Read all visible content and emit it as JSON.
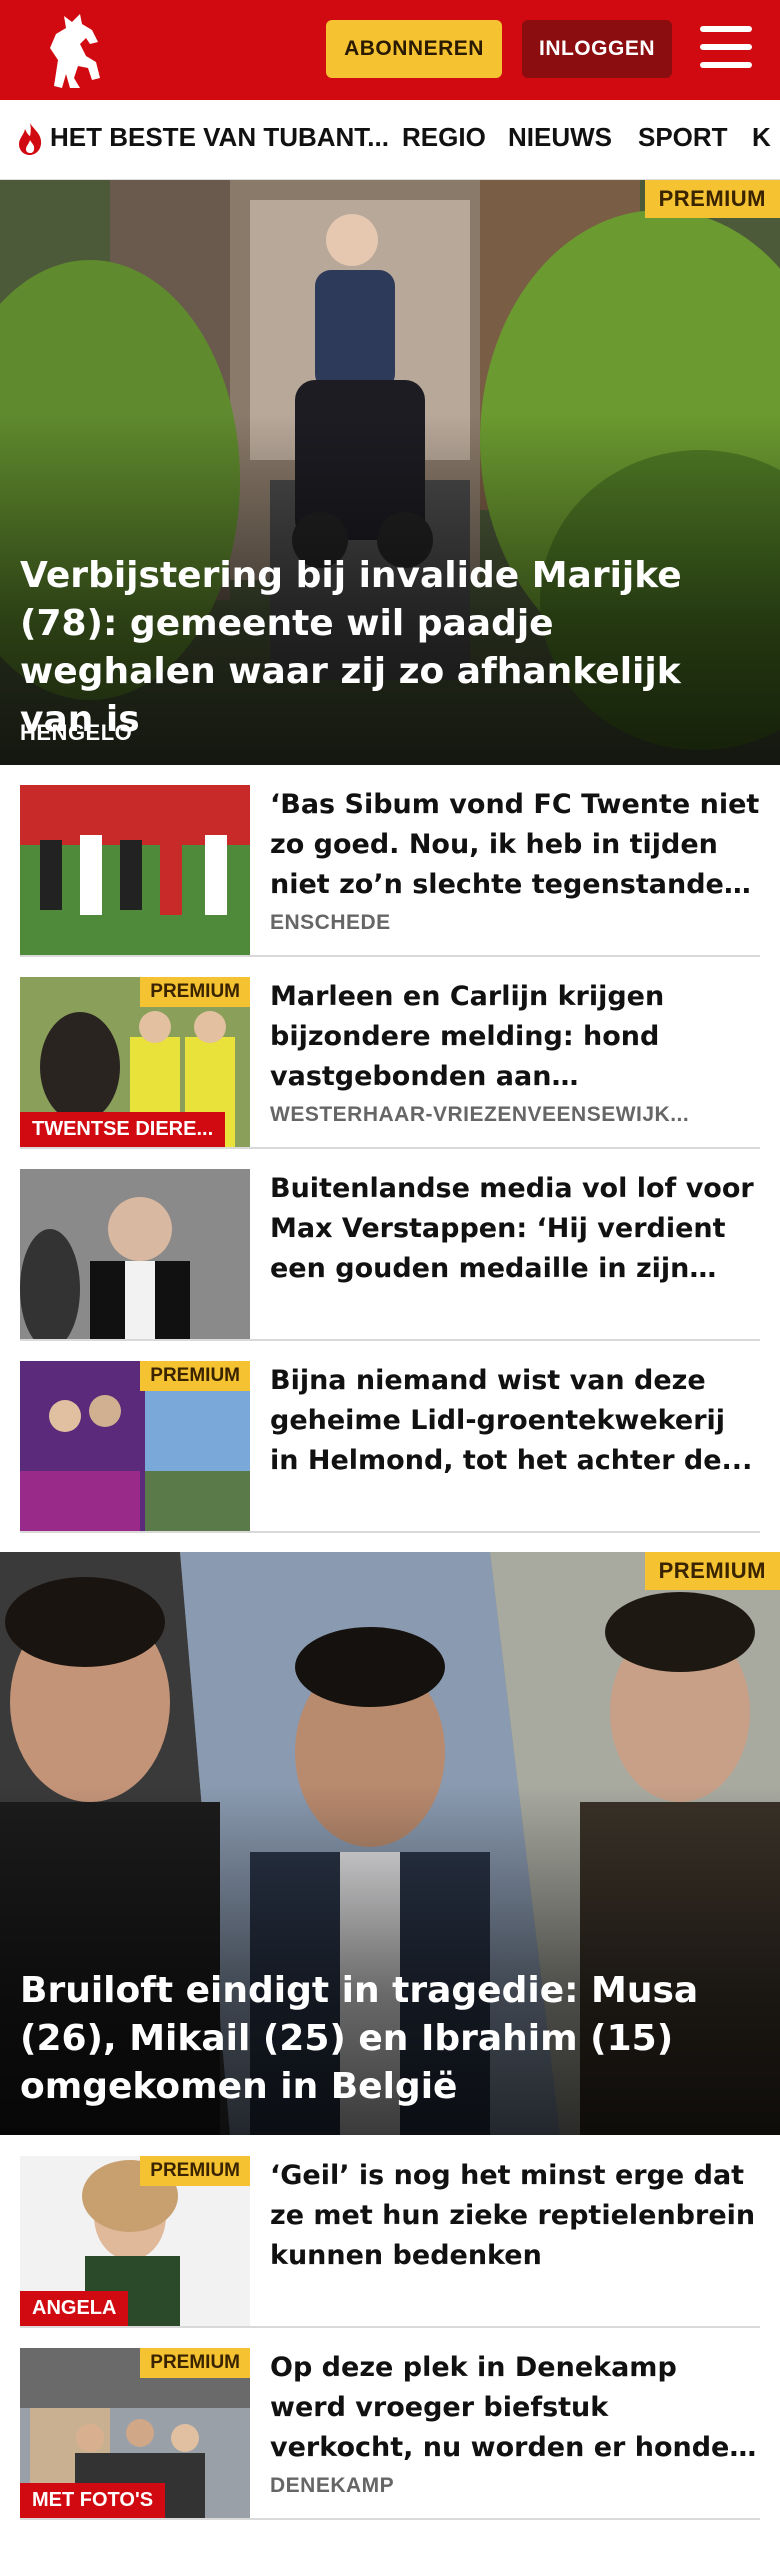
{
  "header": {
    "subscribe_label": "ABONNEREN",
    "login_label": "INLOGGEN",
    "brand_color": "#d10a11",
    "accent_color": "#f5c231"
  },
  "nav": {
    "items": [
      "HET BESTE VAN TUBANT...",
      "REGIO",
      "NIEUWS",
      "SPORT",
      "K"
    ]
  },
  "hero1": {
    "badge": "PREMIUM",
    "title": "Verbijstering bij invalide Marijke (78): gemeente wil paadje weghalen waar zij zo afhankelijk van is",
    "location": "HENGELO"
  },
  "articles": [
    {
      "title": "‘Bas Sibum vond FC Twente niet zo goed. Nou, ik heb in tijden niet zo’n slechte tegenstander gezie...",
      "location": "ENSCHEDE"
    },
    {
      "badge": "PREMIUM",
      "tag": "TWENTSE DIERE...",
      "title": "Marleen en Carlijn krijgen bijzondere melding: hond vastgebonden aan vrachtwage...",
      "location": "WESTERHAAR-VRIEZENVEENSEWIJK..."
    },
    {
      "title": "Buitenlandse media vol lof voor Max Verstappen: ‘Hij verdient een gouden medaille in zijn jacht op..."
    },
    {
      "badge": "PREMIUM",
      "title": "Bijna niemand wist van deze geheime Lidl-groentekwekerij in Helmond, tot het achter de..."
    }
  ],
  "hero2": {
    "badge": "PREMIUM",
    "title": "Bruiloft eindigt in tragedie: Musa (26), Mikail (25) en Ibrahim (15) omgekomen in België"
  },
  "articles2": [
    {
      "badge": "PREMIUM",
      "tag": "ANGELA",
      "title": "‘Geil’ is nog het minst erge dat ze met hun zieke reptielenbrein kunnen bedenken"
    },
    {
      "badge": "PREMIUM",
      "tag": "MET FOTO'S",
      "title": "Op deze plek in Denekamp werd vroeger biefstuk verkocht, nu worden er honden en katten...",
      "location": "DENEKAMP"
    }
  ]
}
